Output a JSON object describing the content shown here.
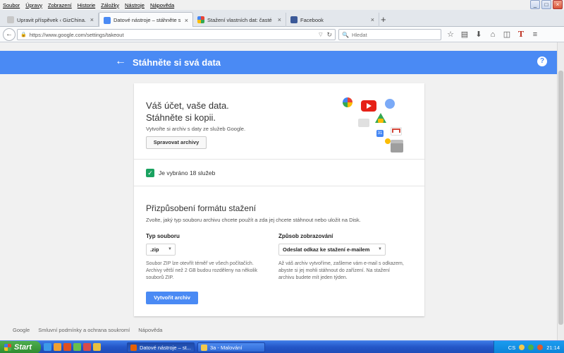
{
  "menu": [
    "Soubor",
    "Úpravy",
    "Zobrazení",
    "Historie",
    "Záložky",
    "Nástroje",
    "Nápověda"
  ],
  "window_controls": {
    "minimize": "_",
    "maximize": "□",
    "close": "×"
  },
  "tabs": [
    {
      "label": "Upravit příspěvek ‹ GizChina.cz – ...",
      "color": "#c7c7c7",
      "close": "×"
    },
    {
      "label": "Datové nástroje – stáhněte si...",
      "color": "#4a8af4",
      "close": "×"
    },
    {
      "label": "Stažení vlastních dat: časté d...",
      "color": "#4a8af4",
      "close": "×"
    },
    {
      "label": "Facebook",
      "color": "#3b5998",
      "close": "×"
    }
  ],
  "new_tab": "+",
  "nav": {
    "url": "https://www.google.com/settings/takeout",
    "search_placeholder": "Hledat"
  },
  "header": {
    "title": "Stáhněte si svá data"
  },
  "hero": {
    "line1": "Váš účet, vaše data.",
    "line2": "Stáhněte si kopii.",
    "subtitle": "Vytvořte si archiv s daty ze služeb Google.",
    "manage_label": "Spravovat archivy"
  },
  "selection": {
    "label": "Je vybráno 18 služeb"
  },
  "format": {
    "title": "Přizpůsobení formátu stažení",
    "description": "Zvolte, jaký typ souboru archivu chcete použít a zda jej chcete stáhnout nebo uložit na Disk.",
    "file_type_title": "Typ souboru",
    "file_type_value": ".zip",
    "file_type_help": [
      "Soubor ZIP lze otevřít téměř ve všech počítačích.",
      "Archivy větší než 2 GB budou rozděleny na několik",
      "souborů ZIP."
    ],
    "delivery_title": "Způsob zobrazování",
    "delivery_value": "Odeslat odkaz ke stažení e-mailem",
    "delivery_help": [
      "Až váš archiv vytvoříme, zašleme vám e-mail s odkazem,",
      "abyste si jej mohli stáhnout do zařízení. Na stažení",
      "archivu budete mít jeden týden."
    ],
    "create_label": "Vytvořit archiv"
  },
  "footer": [
    "Google",
    "Smluvní podmínky a ochrana soukromí",
    "Nápověda"
  ],
  "taskbar": {
    "start": "Start",
    "tasks": [
      "Datové nástroje – st...",
      "3a - Malování"
    ],
    "tray_lang": "CS",
    "clock": "21:14"
  },
  "colors": {
    "header_blue": "#4a8af4",
    "check_green": "#1aa260"
  }
}
